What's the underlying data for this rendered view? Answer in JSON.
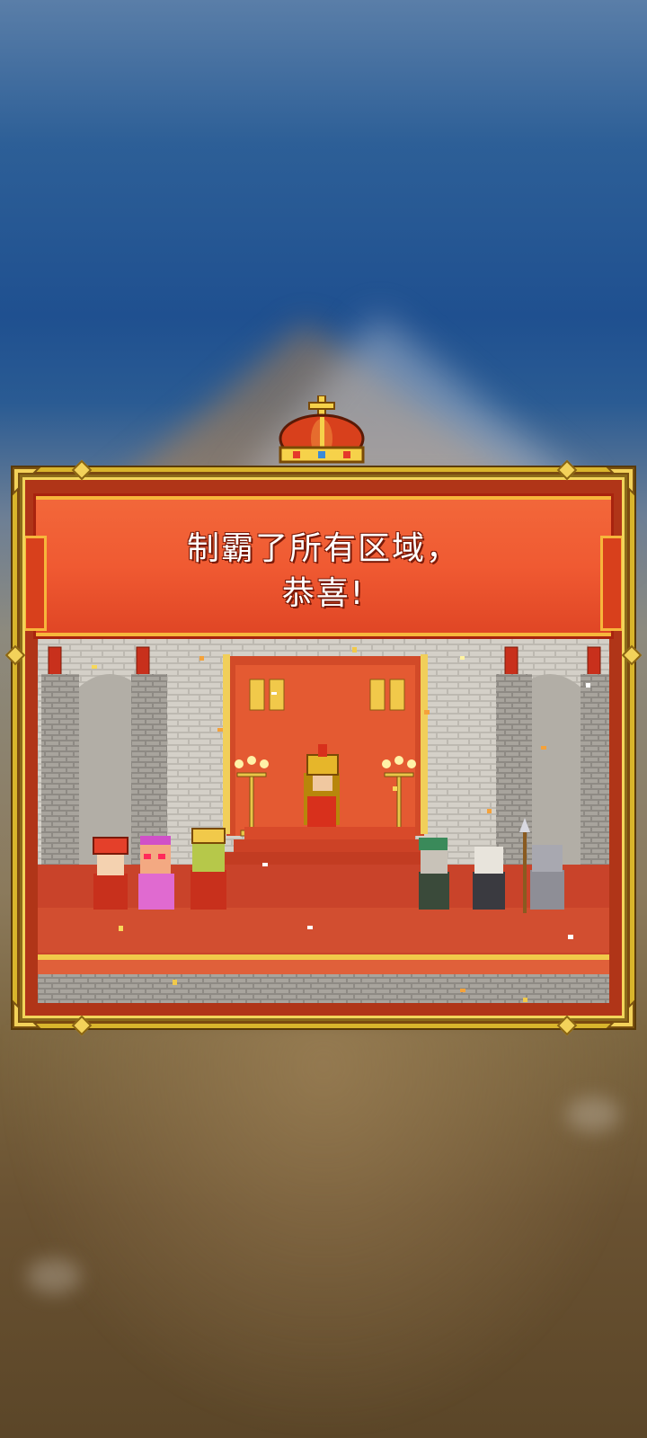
{
  "banner": {
    "line1": "制霸了所有区域，",
    "line2": "恭喜!"
  },
  "icons": {
    "crown": "crown-icon",
    "throne_king": "king-character",
    "characters_left": [
      "queen-character",
      "princess-character",
      "prince-character"
    ],
    "characters_right": [
      "explorer-character",
      "elder-character",
      "knight-character"
    ]
  },
  "colors": {
    "banner_red": "#f05a32",
    "frame_gold": "#d9b52c",
    "carpet": "#c9432a"
  }
}
